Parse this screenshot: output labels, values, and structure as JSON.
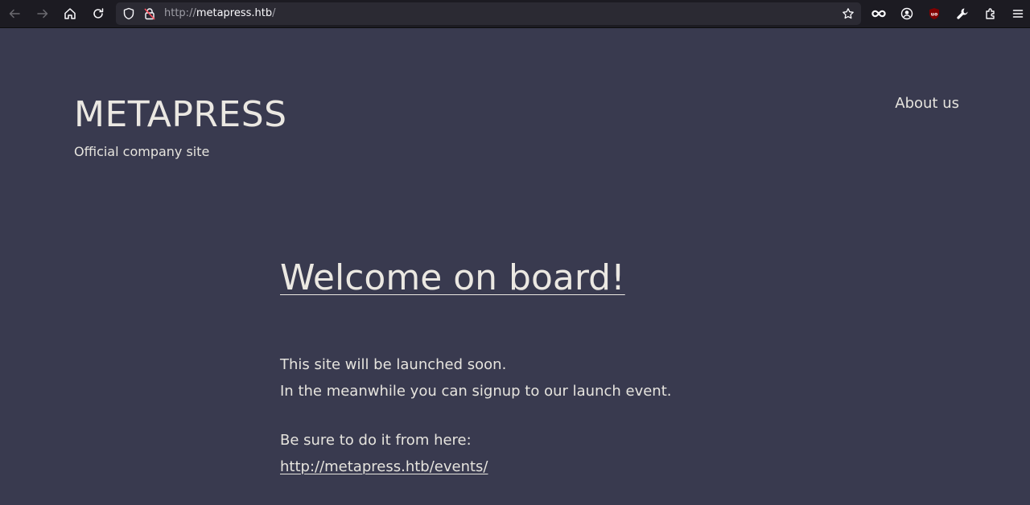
{
  "browser": {
    "url_prefix": "http://",
    "url_host": "metapress.htb",
    "url_suffix": "/",
    "icons": {
      "back": "arrow-left-icon",
      "forward": "arrow-right-icon",
      "home": "home-icon",
      "reload": "reload-icon",
      "tracking": "shield-icon",
      "insecure": "insecure-lock-icon",
      "bookmark": "star-icon",
      "ext1": "infinity-icon",
      "account": "account-icon",
      "ublock": "ublock-icon",
      "tools": "wrench-icon",
      "extensions": "puzzle-icon",
      "menu": "hamburger-menu-icon"
    },
    "ublock_label": "uo"
  },
  "site": {
    "title": "METAPRESS",
    "tagline": "Official company site",
    "nav": {
      "about": "About us"
    }
  },
  "main": {
    "heading": "Welcome on board!",
    "line1": "This site will be launched soon.",
    "line2": "In the meanwhile you can signup to our launch event.",
    "line3": "Be sure to do it from here:",
    "link": "http://metapress.htb/events/"
  },
  "colors": {
    "page_bg": "#393a4f",
    "toolbar_bg": "#1c1b22",
    "urlbar_bg": "#2b2a33",
    "text": "#e6e4de",
    "ublock_red": "#800000"
  }
}
